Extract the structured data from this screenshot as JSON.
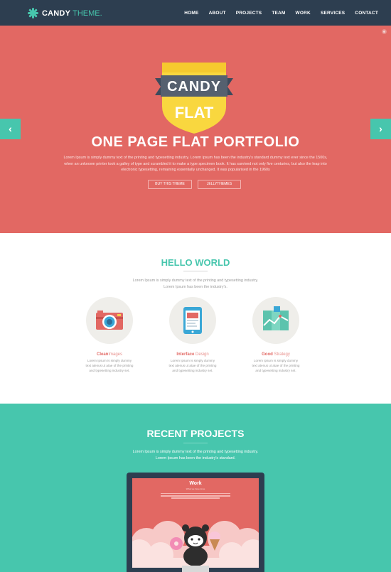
{
  "brand": {
    "name": "CANDY",
    "suffix": "THEME."
  },
  "nav": {
    "items": [
      "HOME",
      "ABOUT",
      "PROJECTS",
      "TEAM",
      "WORK",
      "SERVICES",
      "CONTACT"
    ]
  },
  "hero": {
    "badge_top": "CANDY",
    "badge_bottom": "FLAT",
    "title": "ONE PAGE FLAT PORTFOLIO",
    "text": "Lorem Ipsum is simply dummy text of the printing and typesetting industry. Lorem Ipsum has been the industry's standard dummy text ever since the 1500s, when an unknown printer took a galley of type and scrambled it to make a type specimen book. It has survived not only five centuries, but also the leap into electronic typesetting, remaining essentially unchanged. It was popularised in the 1960s",
    "buttons": [
      "BUY THIS THEME",
      "JELLYTHEMES"
    ],
    "prev_icon": "‹",
    "next_icon": "›"
  },
  "hello": {
    "title": "HELLO WORLD",
    "text": "Lorem Ipsum is simply dummy text of the printing and typesetting industry. Lorem Ipsum has been the industry's.",
    "features": [
      {
        "title_a": "Clean",
        "title_b": "Images",
        "icon": "camera-icon",
        "text": "Lorem Ipsum is simply dummy text atenus ut atae of the printing and typesetting industry set."
      },
      {
        "title_a": "Interface",
        "title_b": "Design",
        "icon": "tablet-icon",
        "text": "Lorem Ipsum is simply dummy text atenus ut atae of the printing and typesetting industry set."
      },
      {
        "title_a": "Good",
        "title_b": "Strategy",
        "icon": "map-icon",
        "text": "Lorem Ipsum is simply dummy text atenus ut atae of the printing and typesetting industry set."
      }
    ]
  },
  "projects": {
    "title": "RECENT PROJECTS",
    "text": "Lorem Ipsum is simply dummy text of the printing and typesetting industry. Lorem Ipsum has been the industry's standard.",
    "screen_title": "Work",
    "screen_sub": "What we have done"
  },
  "colors": {
    "nav": "#2d3e50",
    "hero": "#e26863",
    "accent": "#47c6ad",
    "badge_yellow": "#f9d73f"
  }
}
